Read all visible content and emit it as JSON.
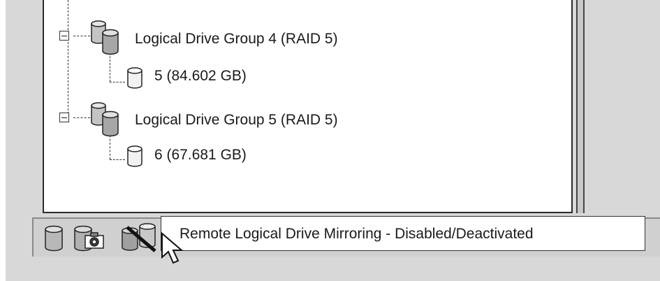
{
  "tree": {
    "groups": [
      {
        "label": "Logical Drive Group 4 (RAID 5)",
        "drives": [
          {
            "label": "5 (84.602 GB)"
          }
        ]
      },
      {
        "label": "Logical Drive Group 5 (RAID 5)",
        "drives": [
          {
            "label": "6 (67.681 GB)"
          }
        ]
      }
    ]
  },
  "statusbar": {
    "icons": [
      "logical-drive-icon",
      "snapshot-drive-icon",
      "mirroring-disabled-icon"
    ]
  },
  "tooltip": {
    "text": "Remote Logical Drive Mirroring - Disabled/Deactivated"
  },
  "cursor": {
    "icon": "mouse-pointer-icon"
  }
}
